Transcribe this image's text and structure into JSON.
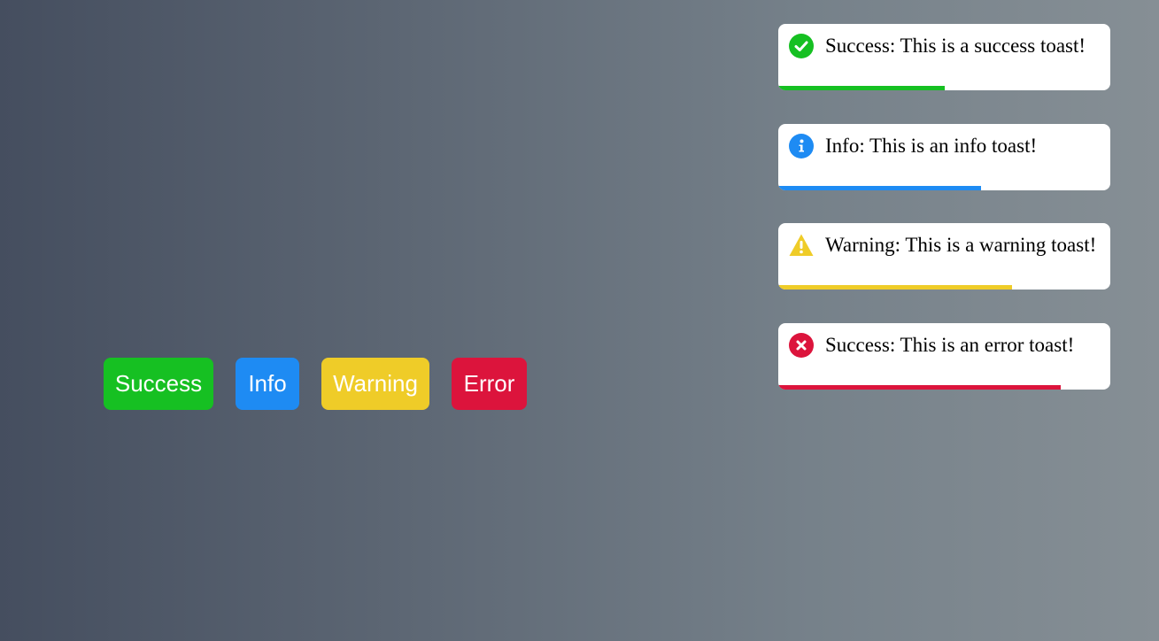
{
  "buttons": [
    {
      "label": "Success",
      "color": "#16c022"
    },
    {
      "label": "Info",
      "color": "#1e8bf3"
    },
    {
      "label": "Warning",
      "color": "#efcc28"
    },
    {
      "label": "Error",
      "color": "#dc143c"
    }
  ],
  "toasts": [
    {
      "type": "success",
      "icon": "check-circle-icon",
      "text": "Success: This is a success toast!",
      "color": "#16c022",
      "progress": 0.5
    },
    {
      "type": "info",
      "icon": "info-circle-icon",
      "text": "Info: This is an info toast!",
      "color": "#1e8bf3",
      "progress": 0.61
    },
    {
      "type": "warning",
      "icon": "warning-triangle-icon",
      "text": "Warning: This is a warning toast!",
      "color": "#efcc28",
      "progress": 0.705
    },
    {
      "type": "error",
      "icon": "error-circle-icon",
      "text": "Success: This is an error toast!",
      "color": "#dc143c",
      "progress": 0.85
    }
  ]
}
